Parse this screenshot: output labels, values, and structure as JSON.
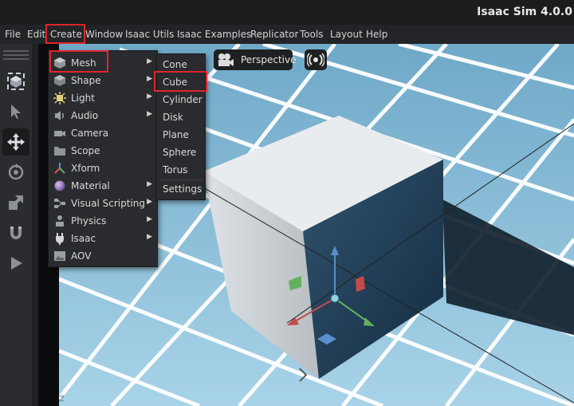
{
  "app": {
    "title": "Isaac Sim 4.0.0"
  },
  "menubar": [
    "File",
    "Edit",
    "Create",
    "Window",
    "Isaac Utils",
    "Isaac Examples",
    "Replicator",
    "Tools",
    "Layout",
    "Help"
  ],
  "viewport": {
    "camera_label": "Perspective",
    "axis_label": "Z"
  },
  "create_menu": {
    "items": [
      {
        "label": "Mesh",
        "icon": "cube-icon",
        "submenu": true
      },
      {
        "label": "Shape",
        "icon": "shape-icon",
        "submenu": true
      },
      {
        "label": "Light",
        "icon": "light-icon",
        "submenu": true
      },
      {
        "label": "Audio",
        "icon": "speaker-icon",
        "submenu": true
      },
      {
        "label": "Camera",
        "icon": "camera-icon",
        "submenu": false
      },
      {
        "label": "Scope",
        "icon": "folder-icon",
        "submenu": false
      },
      {
        "label": "Xform",
        "icon": "xform-icon",
        "submenu": false
      },
      {
        "label": "Material",
        "icon": "sphere-icon",
        "submenu": true
      },
      {
        "label": "Visual Scripting",
        "icon": "graph-icon",
        "submenu": true
      },
      {
        "label": "Physics",
        "icon": "physics-icon",
        "submenu": true
      },
      {
        "label": "Isaac",
        "icon": "plug-icon",
        "submenu": true
      },
      {
        "label": "AOV",
        "icon": "image-icon",
        "submenu": false
      }
    ]
  },
  "mesh_submenu": {
    "items": [
      "Cone",
      "Cube",
      "Cylinder",
      "Disk",
      "Plane",
      "Sphere",
      "Torus"
    ],
    "footer": "Settings"
  },
  "colors": {
    "highlight": "#e0242b",
    "floor": "#8fc3dc",
    "grid": "#ffffff"
  }
}
